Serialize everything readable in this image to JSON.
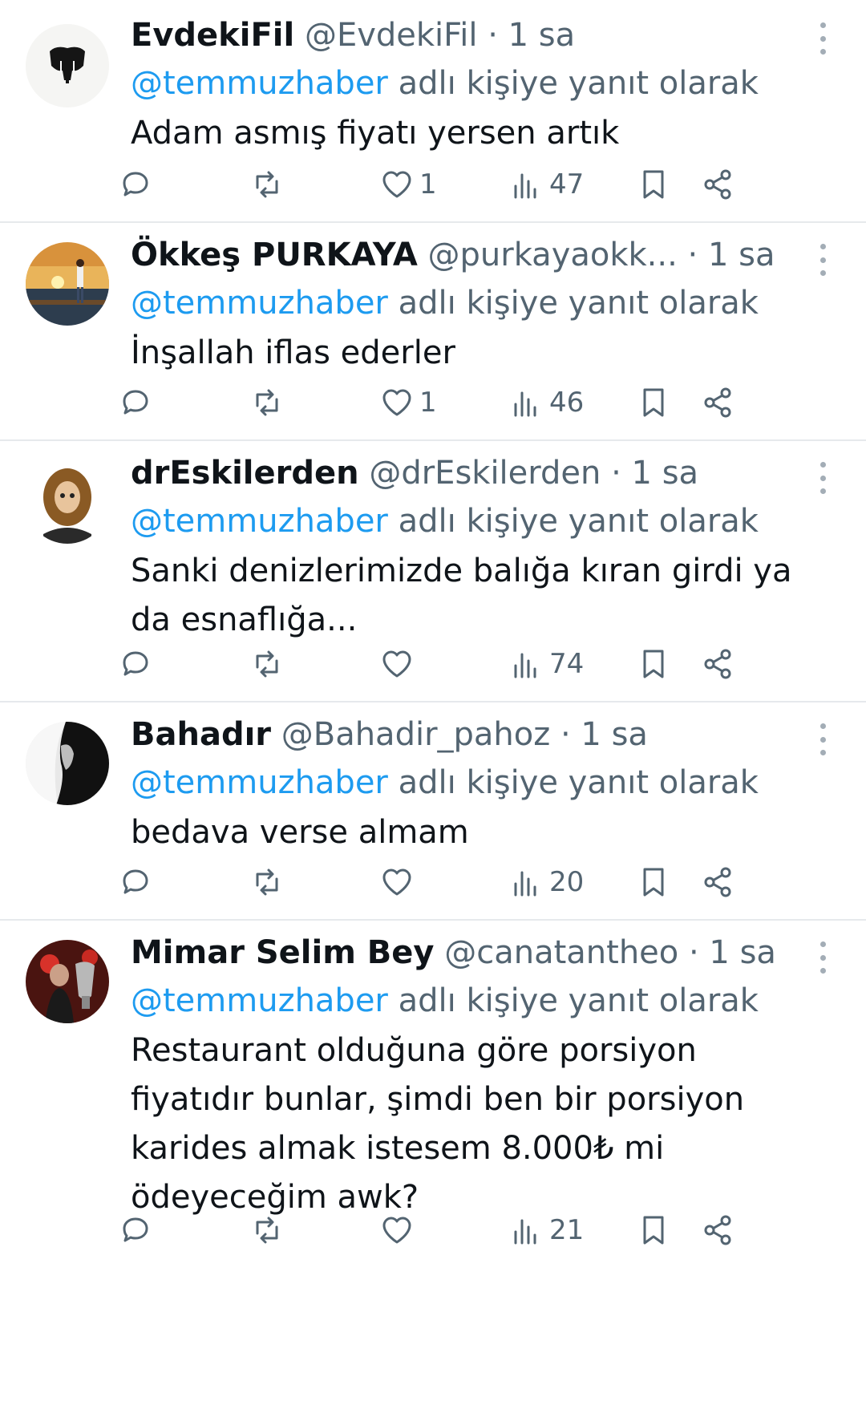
{
  "reply_prefix": "adlı kişiye yanıt olarak",
  "colors": {
    "name": "#0f1419",
    "muted": "#536471",
    "link": "#1d9bf0",
    "divider": "#e6e9ec"
  },
  "tweets": [
    {
      "name": "EvdekiFil",
      "handle": "@EvdekiFil",
      "time": "· 1 sa",
      "reply_to": "@temmuzhaber",
      "text": "Adam asmış fiyatı yersen artık",
      "likes": "1",
      "views": "47",
      "avatar": "elephant-avatar"
    },
    {
      "name": "Ökkeş PURKAYA",
      "handle": "@purkayaokk...",
      "time": "· 1 sa",
      "reply_to": "@temmuzhaber",
      "text": "İnşallah iflas ederler",
      "likes": "1",
      "views": "46",
      "avatar": "sunset-avatar"
    },
    {
      "name": "drEskilerden",
      "handle": "@drEskilerden",
      "time": "· 1 sa",
      "reply_to": "@temmuzhaber",
      "text": "Sanki denizlerimizde balığa kıran girdi ya\nda esnaflığa...",
      "likes": "",
      "views": "74",
      "avatar": "cartoon-avatar"
    },
    {
      "name": "Bahadır",
      "handle": "@Bahadir_pahoz",
      "time": "· 1 sa",
      "reply_to": "@temmuzhaber",
      "text": "bedava verse almam",
      "likes": "",
      "views": "20",
      "avatar": "portrait-avatar"
    },
    {
      "name": "Mimar Selim Bey",
      "handle": "@canatantheo",
      "time": "· 1 sa",
      "reply_to": "@temmuzhaber",
      "text": "Restaurant olduğuna göre porsiyon\nfiyatıdır bunlar, şimdi ben bir porsiyon\nkarides almak istesem 8.000₺ mi\nödeyeceğim awk?",
      "likes": "",
      "views": "21",
      "avatar": "trophy-avatar"
    }
  ]
}
